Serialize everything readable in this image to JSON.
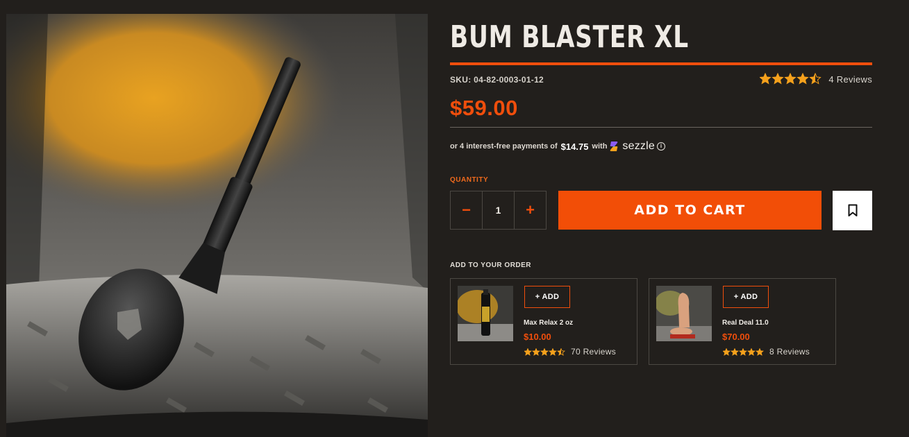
{
  "product": {
    "title": "BUM BLASTER XL",
    "sku": "SKU: 04-82-0003-01-12",
    "rating": 4.5,
    "reviews": "4 Reviews",
    "price": "$59.00"
  },
  "sezzle": {
    "prefix": "or 4 interest-free payments of",
    "amount": "$14.75",
    "with": "with",
    "brand": "sezzle",
    "info": "i"
  },
  "quantity": {
    "label": "QUANTITY",
    "value": "1",
    "minus": "−",
    "plus": "+"
  },
  "cart": {
    "add_label": "ADD TO CART"
  },
  "addons": {
    "label": "ADD TO YOUR ORDER",
    "items": [
      {
        "button": "+ ADD",
        "name": "Max Relax 2 oz",
        "price": "$10.00",
        "rating": 4.5,
        "reviews": "70 Reviews"
      },
      {
        "button": "+ ADD",
        "name": "Real Deal 11.0",
        "price": "$70.00",
        "rating": 5,
        "reviews": "8 Reviews"
      }
    ]
  },
  "colors": {
    "accent": "#f04e0c",
    "star": "#f5a11c",
    "background": "#221f1c"
  },
  "icons": {
    "wishlist": "bookmark-icon",
    "star": "star-icon",
    "sezzle_logo": "sezzle-logo-icon"
  }
}
